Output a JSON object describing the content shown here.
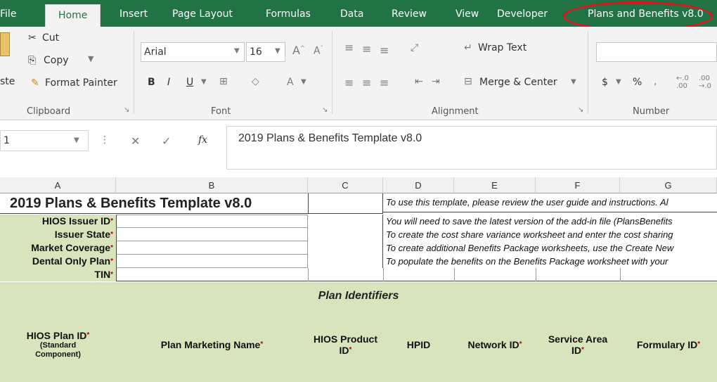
{
  "ribbon_tabs": {
    "file": "File",
    "home": "Home",
    "insert": "Insert",
    "page_layout": "Page Layout",
    "formulas": "Formulas",
    "data": "Data",
    "review": "Review",
    "view": "View",
    "developer": "Developer",
    "plans": "Plans and Benefits v8.0"
  },
  "clipboard": {
    "cut": "Cut",
    "copy": "Copy",
    "paste": "ste",
    "format_painter": "Format Painter",
    "group": "Clipboard"
  },
  "font": {
    "name": "Arial",
    "size": "16",
    "group": "Font"
  },
  "alignment": {
    "wrap": "Wrap Text",
    "merge": "Merge & Center",
    "group": "Alignment"
  },
  "number": {
    "group": "Number",
    "currency": "$",
    "percent": "%"
  },
  "formula_bar": {
    "name_box": "1",
    "fx": "fx",
    "content": "2019 Plans & Benefits Template v8.0"
  },
  "columns": [
    "A",
    "B",
    "C",
    "D",
    "E",
    "F",
    "G"
  ],
  "sheet": {
    "title": "2019 Plans & Benefits Template v8.0",
    "labels": [
      "HIOS Issuer ID",
      "Issuer State",
      "Market Coverage",
      "Dental Only Plan",
      "TIN"
    ],
    "notes": [
      "To use this template, please review the user guide and instructions. Al",
      "You will need to save the latest version of the add-in file (PlansBenefits",
      "To create the cost share variance worksheet and enter the cost sharing",
      "To create additional Benefits Package worksheets, use the Create New",
      "To populate the benefits on the Benefits Package worksheet with your"
    ],
    "section": "Plan Identifiers",
    "headers": {
      "hios_plan_id": "HIOS Plan ID",
      "standard_component": "(Standard Component)",
      "plan_marketing_name": "Plan Marketing Name",
      "hios_product": "HIOS Product",
      "id": "ID",
      "hpid": "HPID",
      "network_id": "Network ID",
      "service_area": "Service Area",
      "formulary_id": "Formulary ID"
    },
    "required_mark": "*"
  },
  "colors": {
    "accent": "#217346",
    "highlight_ring": "#e8101b",
    "label_bg": "#d8e4bc"
  }
}
